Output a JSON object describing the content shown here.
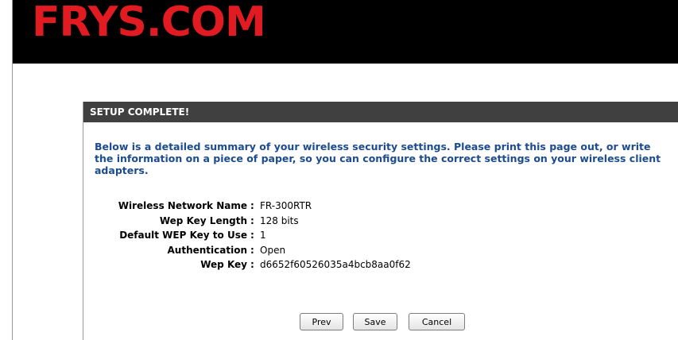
{
  "header": {
    "logo_text": "FRYS.COM",
    "brand_color": "#e21b22",
    "background": "#000000"
  },
  "panel": {
    "title": "SETUP COMPLETE!",
    "intro": "Below is a detailed summary of your wireless security settings. Please print this page out, or write the information on a piece of paper, so you can configure the correct settings on your wireless client adapters.",
    "rows": [
      {
        "label": "Wireless Network Name",
        "separator": ":",
        "value": "FR-300RTR"
      },
      {
        "label": "Wep Key Length",
        "separator": ":",
        "value": "128 bits"
      },
      {
        "label": "Default WEP Key to Use",
        "separator": ":",
        "value": "1"
      },
      {
        "label": "Authentication",
        "separator": ":",
        "value": "Open"
      },
      {
        "label": "Wep Key",
        "separator": ":",
        "value": "d6652f60526035a4bcb8aa0f62"
      }
    ]
  },
  "buttons": {
    "prev": "Prev",
    "save": "Save",
    "cancel": "Cancel"
  }
}
